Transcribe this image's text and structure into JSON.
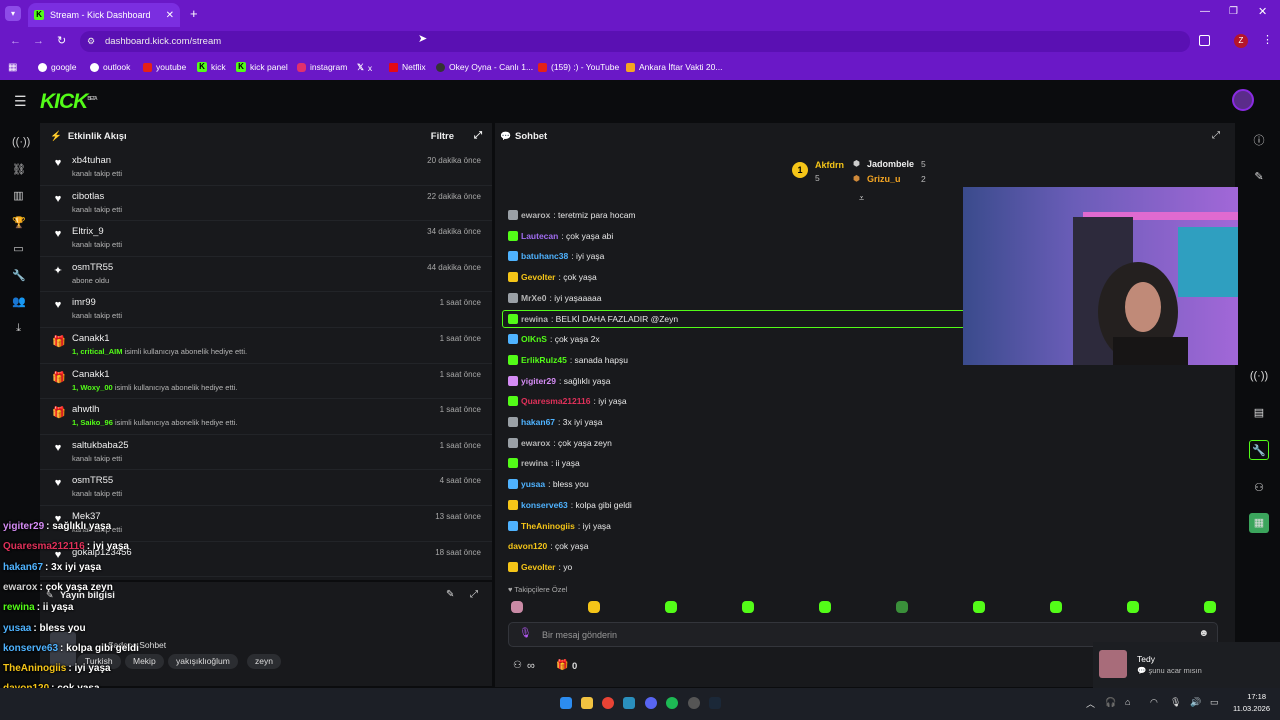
{
  "browser": {
    "tab_title": "Stream - Kick Dashboard",
    "url": "dashboard.kick.com/stream",
    "profile": "Z",
    "bookmarks": [
      "google",
      "outlook",
      "youtube",
      "kick",
      "kick panel",
      "instagram",
      "x",
      "Netflix",
      "Okey Oyna - Canlı 1...",
      "(159) :) - YouTube",
      "Ankara İftar Vakti 20..."
    ]
  },
  "brand": {
    "logo": "KICK",
    "beta": "BETA",
    "accent": "#53fc18"
  },
  "activity": {
    "title": "Etkinlik Akışı",
    "filter": "Filtre",
    "items": [
      {
        "name": "xb4tuhan",
        "sub": "kanalı takip etti",
        "time": "20 dakika önce",
        "icon": "heart-icon"
      },
      {
        "name": "cibotlas",
        "sub": "kanalı takip etti",
        "time": "22 dakika önce",
        "icon": "heart-icon"
      },
      {
        "name": "Eltrix_9",
        "sub": "kanalı takip etti",
        "time": "34 dakika önce",
        "icon": "heart-icon"
      },
      {
        "name": "osmTR55",
        "sub": "abone oldu",
        "time": "44 dakika önce",
        "icon": "sparkle-icon"
      },
      {
        "name": "imr99",
        "sub": "kanalı takip etti",
        "time": "1 saat önce",
        "icon": "heart-icon"
      },
      {
        "name": "Canakk1",
        "gift": "1, critical_AIM",
        "sub": " isimli kullanıcıya abonelik hediye etti.",
        "time": "1 saat önce",
        "icon": "gift-icon"
      },
      {
        "name": "Canakk1",
        "gift": "1, Woxy_00",
        "sub": " isimli kullanıcıya abonelik hediye etti.",
        "time": "1 saat önce",
        "icon": "gift-icon"
      },
      {
        "name": "ahwtlh",
        "gift": "1, Saiko_96",
        "sub": " isimli kullanıcıya abonelik hediye etti.",
        "time": "1 saat önce",
        "icon": "gift-icon"
      },
      {
        "name": "saltukbaba25",
        "sub": "kanalı takip etti",
        "time": "1 saat önce",
        "icon": "heart-icon"
      },
      {
        "name": "osmTR55",
        "sub": "kanalı takip etti",
        "time": "4 saat önce",
        "icon": "heart-icon"
      },
      {
        "name": "Mek37",
        "sub": "kanalı takip etti",
        "time": "13 saat önce",
        "icon": "heart-icon"
      },
      {
        "name": "gokalp123456",
        "sub": "",
        "time": "18 saat önce",
        "icon": "heart-icon"
      }
    ]
  },
  "stream_info": {
    "title": "Yayın bilgisi",
    "game": "Sadece Sohbet",
    "tags": [
      "Turkish",
      "Mekip",
      "yakışıklıoğlum",
      "zeyn"
    ]
  },
  "chat": {
    "title": "Sohbet",
    "input_placeholder": "Bir mesaj gönderin",
    "followers_only": "Takipçilere Özel",
    "count_a": "∞",
    "count_b": "0",
    "leaders": {
      "first": {
        "name": "Akfdrn",
        "count": "5"
      },
      "second": {
        "name": "Jadombele",
        "count": "5"
      },
      "third": {
        "name": "Grizu_u",
        "count": "2"
      }
    },
    "messages": [
      {
        "user": "ewarox",
        "text": "teretmiz para hocam",
        "color": "#b5b5b5"
      },
      {
        "user": "Lautecan",
        "text": "çok yaşa abi",
        "color": "#a06cf0"
      },
      {
        "user": "batuhanc38",
        "text": "iyi yaşa",
        "color": "#4fb3ff"
      },
      {
        "user": "Gevolter",
        "text": "çok yaşa",
        "color": "#f5c518"
      },
      {
        "user": "MrXe0",
        "text": "iyi yaşaaaaa",
        "color": "#b5b5b5"
      },
      {
        "user": "rewina",
        "text": "BELKİ DAHA FAZLADIR @Zeyn",
        "color": "#b5b5b5"
      },
      {
        "user": "OlKnS",
        "text": "çok yaşa 2x",
        "color": "#53fc18"
      },
      {
        "user": "ErlikRulz45",
        "text": "sanada hapşu",
        "color": "#53fc18"
      },
      {
        "user": "yigiter29",
        "text": "sağlıklı yaşa",
        "color": "#d58cf5"
      },
      {
        "user": "Quaresma212116",
        "text": "iyi yaşa",
        "color": "#e0315a"
      },
      {
        "user": "hakan67",
        "text": "3x iyi yaşa",
        "color": "#4fb3ff"
      },
      {
        "user": "ewarox",
        "text": "çok yaşa zeyn",
        "color": "#b5b5b5"
      },
      {
        "user": "rewina",
        "text": "ii yaşa",
        "color": "#b5b5b5"
      },
      {
        "user": "yusaa",
        "text": "bless you",
        "color": "#4fb3ff"
      },
      {
        "user": "konserve63",
        "text": "kolpa gibi geldi",
        "color": "#4fb3ff"
      },
      {
        "user": "TheAninogiis",
        "text": "iyi yaşa",
        "color": "#f5c518"
      },
      {
        "user": "davon120",
        "text": "çok yaşa",
        "color": "#f5c518"
      },
      {
        "user": "Gevolter",
        "text": "yo",
        "color": "#f5c518"
      }
    ]
  },
  "overlay": [
    {
      "user": "yigiter29",
      "text": "sağlıklı yaşa",
      "color": "#d58cf5"
    },
    {
      "user": "Quaresma212116",
      "text": "iyi yaşa",
      "color": "#e0315a"
    },
    {
      "user": "hakan67",
      "text": "3x iyi yaşa",
      "color": "#4fb3ff"
    },
    {
      "user": "ewarox",
      "text": "çok yaşa zeyn",
      "color": "#cfcfcf"
    },
    {
      "user": "rewina",
      "text": "ii yaşa",
      "color": "#53fc18"
    },
    {
      "user": "yusaa",
      "text": "bless you",
      "color": "#4fb3ff"
    },
    {
      "user": "konserve63",
      "text": "kolpa gibi geldi",
      "color": "#4fb3ff"
    },
    {
      "user": "TheAninogiis",
      "text": "iyi yaşa",
      "color": "#f5c518"
    },
    {
      "user": "davon120",
      "text": "çok yaşa",
      "color": "#f5c518"
    },
    {
      "user": "Gevolter",
      "text": "yo",
      "color": "#f5c518"
    }
  ],
  "notification": {
    "name": "Tedy",
    "text": "şunu acar mısın"
  },
  "taskbar": {
    "time": "17:18",
    "date": "11.03.2026"
  }
}
